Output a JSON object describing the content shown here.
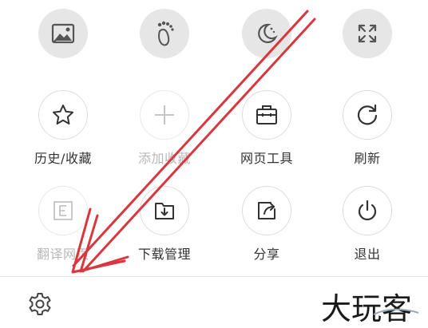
{
  "top_row": [
    {
      "name": "image-mode-button",
      "icon": "image-icon"
    },
    {
      "name": "footprint-button",
      "icon": "footprint-icon"
    },
    {
      "name": "night-mode-button",
      "icon": "moon-icon"
    },
    {
      "name": "fullscreen-button",
      "icon": "fullscreen-icon"
    }
  ],
  "menu": {
    "row1": [
      {
        "label": "历史/收藏",
        "icon": "star-icon",
        "disabled": false
      },
      {
        "label": "添加收藏",
        "icon": "plus-icon",
        "disabled": true
      },
      {
        "label": "网页工具",
        "icon": "toolbox-icon",
        "disabled": false
      },
      {
        "label": "刷新",
        "icon": "refresh-icon",
        "disabled": false
      }
    ],
    "row2": [
      {
        "label": "翻译网页",
        "icon": "translate-icon",
        "disabled": true
      },
      {
        "label": "下载管理",
        "icon": "download-icon",
        "disabled": false
      },
      {
        "label": "分享",
        "icon": "share-icon",
        "disabled": false
      },
      {
        "label": "退出",
        "icon": "power-icon",
        "disabled": false
      }
    ]
  },
  "bottom": {
    "settings_icon": "gear-icon"
  },
  "watermark": {
    "text": "大玩客"
  },
  "annotation": {
    "color": "#d9363e"
  }
}
